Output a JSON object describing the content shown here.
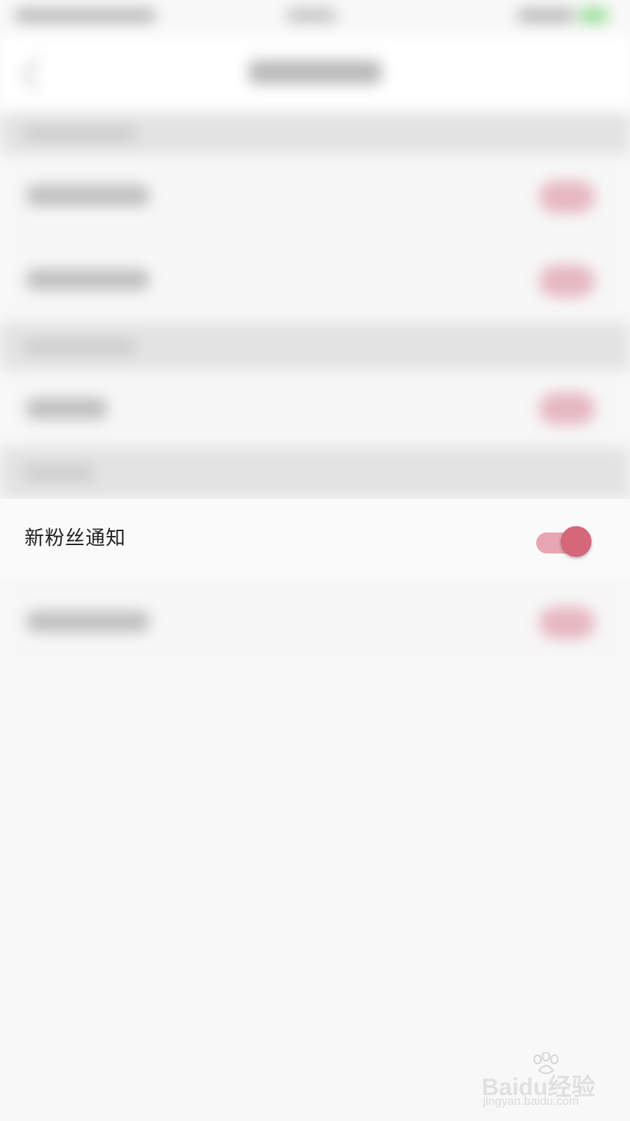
{
  "settings": {
    "new_follower_notification": {
      "label": "新粉丝通知",
      "toggle_state": "on"
    }
  },
  "colors": {
    "accent": "#d6667a",
    "track_on": "#e8a6b3",
    "background": "#f8f8f8"
  },
  "watermark": {
    "logo_text": "Baidu经验",
    "url": "jingyan.baidu.com"
  }
}
